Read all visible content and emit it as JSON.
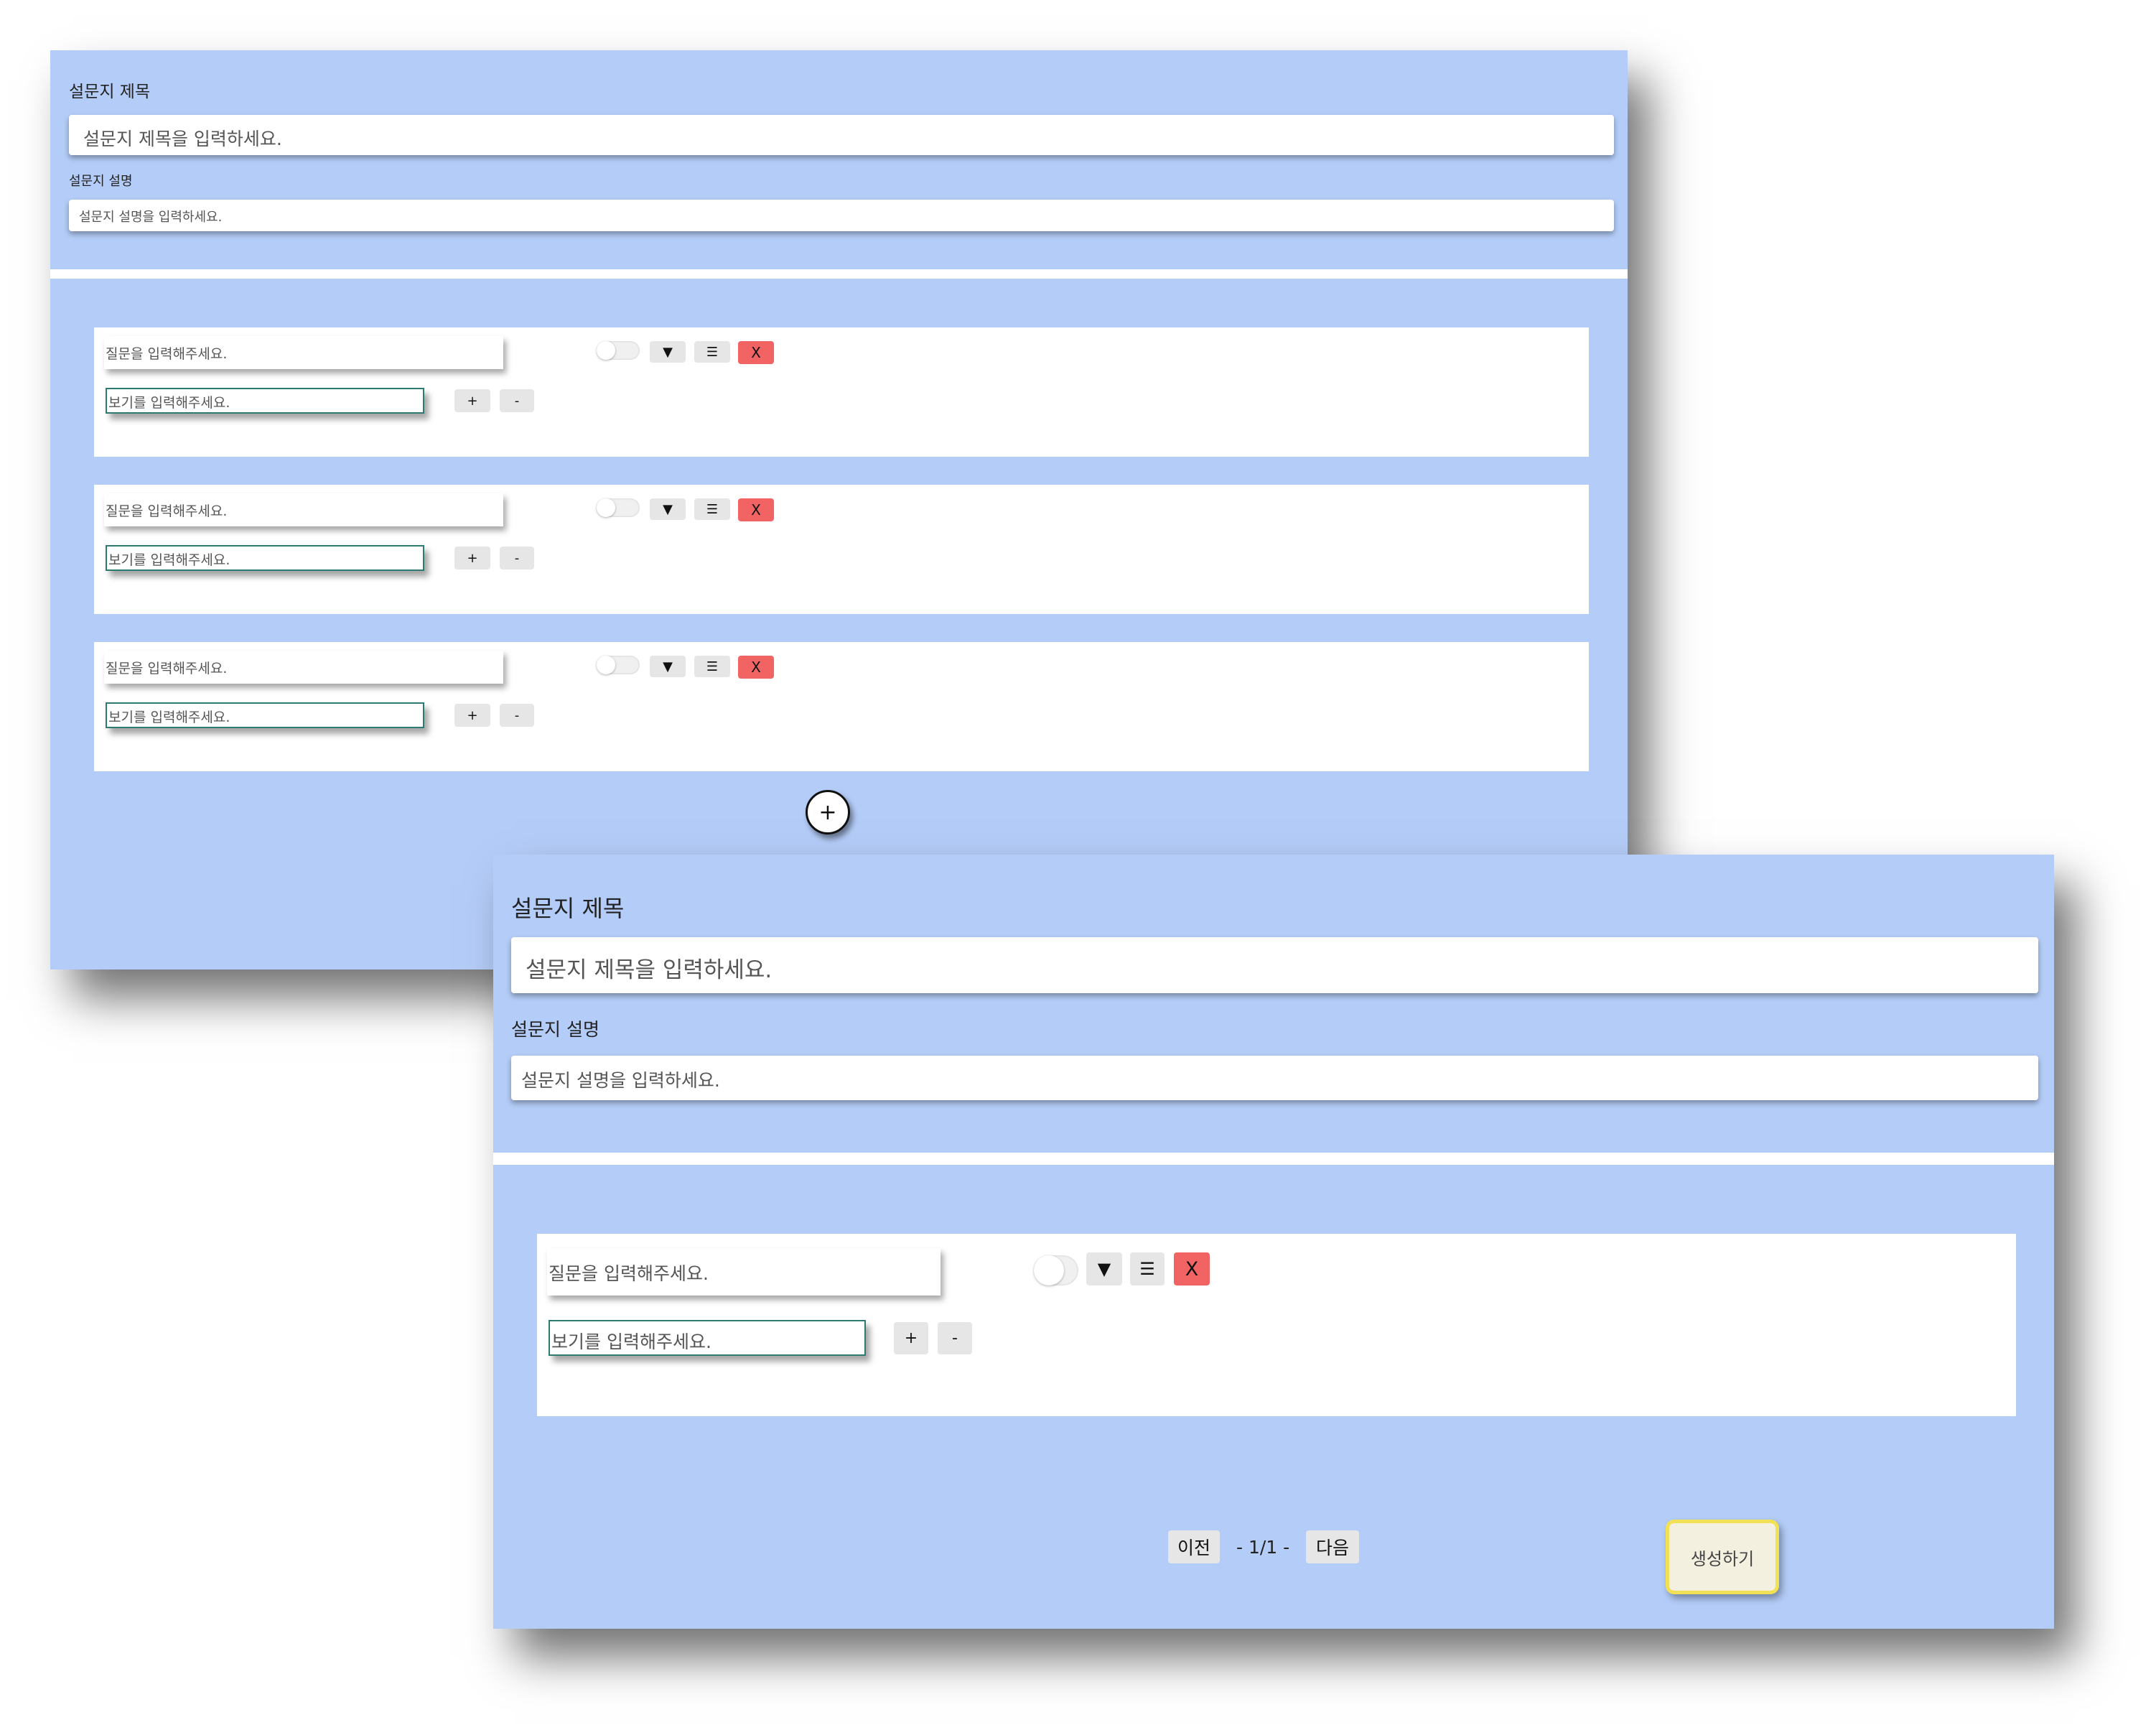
{
  "form": {
    "title_label": "설문지 제목",
    "title_placeholder": "설문지 제목을 입력하세요.",
    "desc_label": "설문지 설명",
    "desc_placeholder": "설문지 설명을 입력하세요."
  },
  "question": {
    "placeholder": "질문을 입력해주세요.",
    "option_placeholder": "보기를 입력해주세요.",
    "dropdown_icon": "▼",
    "menu_icon": "☰",
    "delete_label": "X",
    "add_option": "+",
    "remove_option": "-",
    "required_toggle": false
  },
  "add_question_icon": "+",
  "pagination": {
    "prev_label": "이전",
    "page_indicator": "- 1/1 -",
    "next_label": "다음"
  },
  "create_button": "생성하기",
  "colors": {
    "panel_bg": "#b4cdf8",
    "delete_button": "#f26464",
    "option_border": "#2d7a70",
    "create_border": "#f2e154"
  }
}
